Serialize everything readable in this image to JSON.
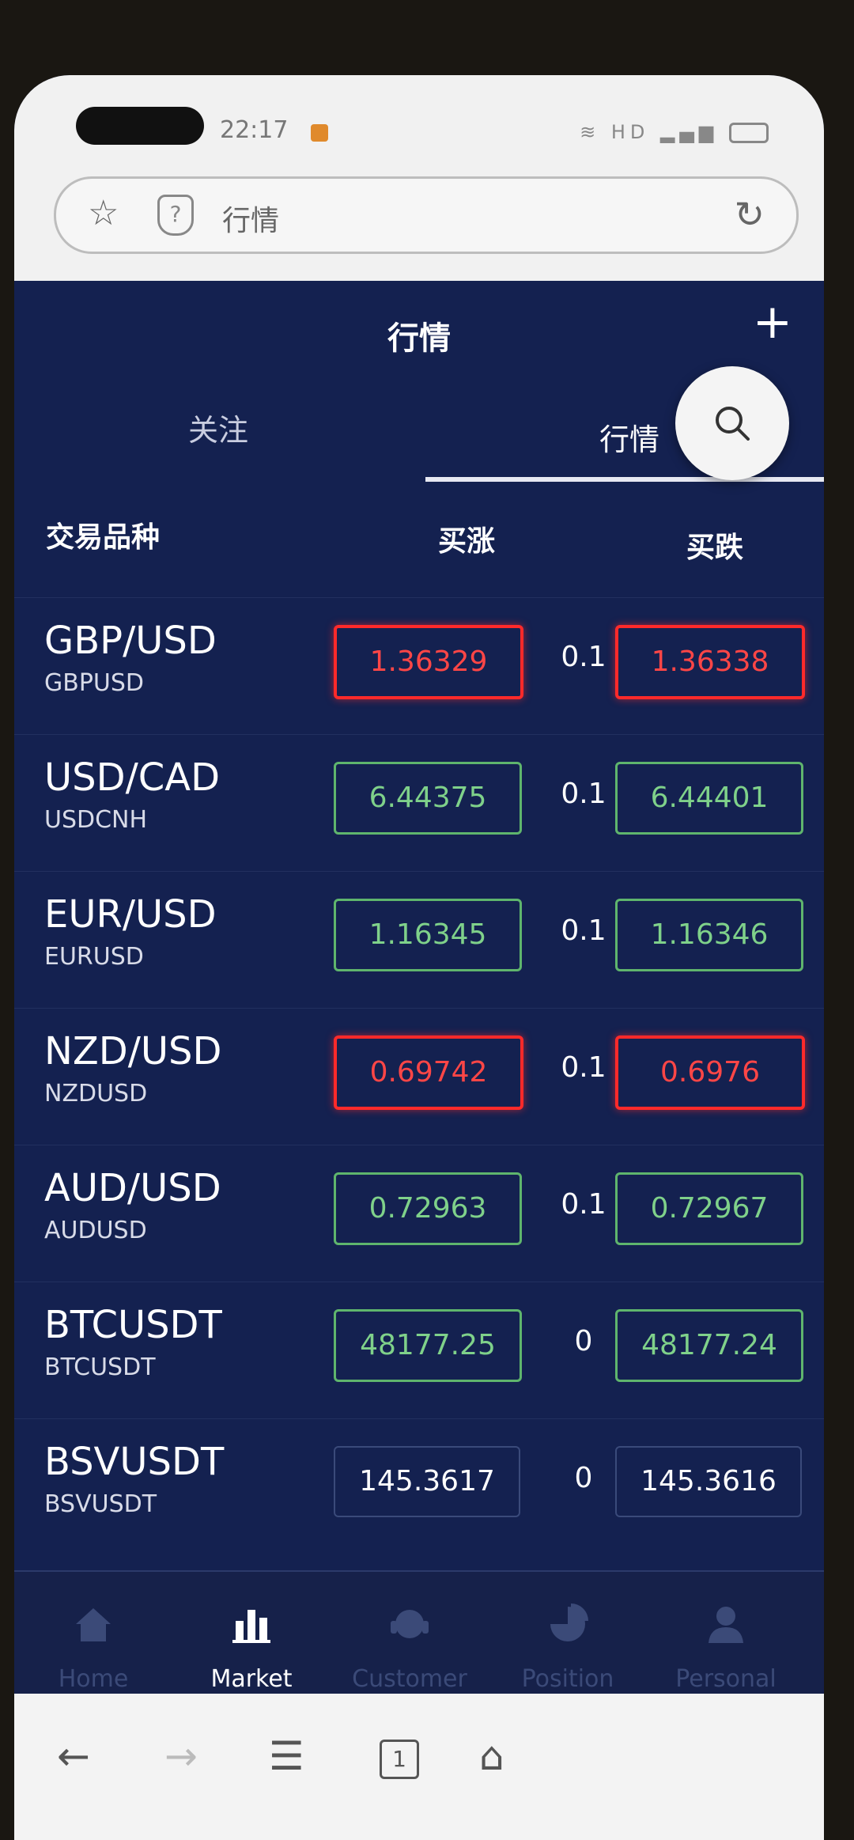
{
  "status": {
    "time": "22:17",
    "indicators": "HD"
  },
  "browser": {
    "url_text": "行情"
  },
  "header": {
    "title": "行情",
    "add_label": "+"
  },
  "tabs": [
    {
      "label": "关注"
    },
    {
      "label": "行情"
    }
  ],
  "columns": {
    "symbol": "交易品种",
    "buy_up": "买涨",
    "buy_down": "买跌"
  },
  "rows": [
    {
      "name": "GBP/USD",
      "code": "GBPUSD",
      "bid": "1.36329",
      "spread": "0.1",
      "ask": "1.36338",
      "trend": "down"
    },
    {
      "name": "USD/CAD",
      "code": "USDCNH",
      "bid": "6.44375",
      "spread": "0.1",
      "ask": "6.44401",
      "trend": "up"
    },
    {
      "name": "EUR/USD",
      "code": "EURUSD",
      "bid": "1.16345",
      "spread": "0.1",
      "ask": "1.16346",
      "trend": "up"
    },
    {
      "name": "NZD/USD",
      "code": "NZDUSD",
      "bid": "0.69742",
      "spread": "0.1",
      "ask": "0.6976",
      "trend": "down"
    },
    {
      "name": "AUD/USD",
      "code": "AUDUSD",
      "bid": "0.72963",
      "spread": "0.1",
      "ask": "0.72967",
      "trend": "up"
    },
    {
      "name": "BTCUSDT",
      "code": "BTCUSDT",
      "bid": "48177.25",
      "spread": "0",
      "ask": "48177.24",
      "trend": "up"
    },
    {
      "name": "BSVUSDT",
      "code": "BSVUSDT",
      "bid": "145.3617",
      "spread": "0",
      "ask": "145.3616",
      "trend": "flat"
    }
  ],
  "nav": [
    {
      "label": "Home",
      "icon": "home-icon"
    },
    {
      "label": "Market",
      "icon": "bar-chart-icon",
      "active": true
    },
    {
      "label": "Customer",
      "icon": "headset-icon"
    },
    {
      "label": "Position",
      "icon": "pie-chart-icon"
    },
    {
      "label": "Personal",
      "icon": "person-icon"
    }
  ],
  "browser_nav": {
    "back": "←",
    "forward": "→",
    "menu": "☰",
    "tabs_count": "1",
    "home": "⌂"
  },
  "colors": {
    "background": "#142150",
    "up": "#5fb56d",
    "down": "#ff2a2a"
  }
}
